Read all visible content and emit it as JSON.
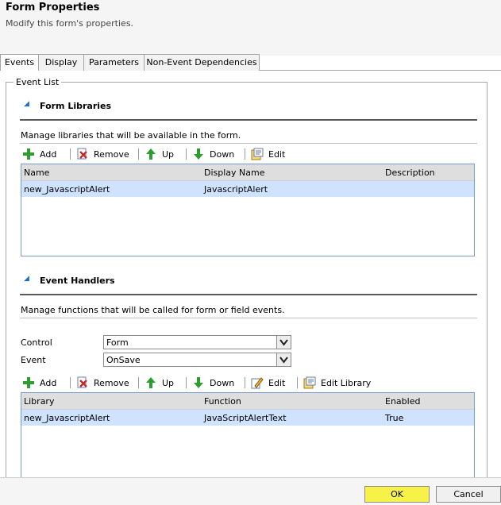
{
  "dialog": {
    "title": "Form Properties",
    "subtitle": "Modify this form's properties."
  },
  "tabs": [
    {
      "label": "Events",
      "active": true
    },
    {
      "label": "Display",
      "active": false
    },
    {
      "label": "Parameters",
      "active": false
    },
    {
      "label": "Non-Event Dependencies",
      "active": false
    }
  ],
  "event_list": {
    "legend": "Event List",
    "form_libraries": {
      "heading": "Form Libraries",
      "description": "Manage libraries that will be available in the form.",
      "toolbar": {
        "add": "Add",
        "remove": "Remove",
        "up": "Up",
        "down": "Down",
        "edit": "Edit"
      },
      "columns": [
        "Name",
        "Display Name",
        "Description"
      ],
      "rows": [
        [
          "new_JavascriptAlert",
          "JavascriptAlert",
          ""
        ]
      ]
    },
    "event_handlers": {
      "heading": "Event Handlers",
      "description": "Manage functions that will be called for form or field events.",
      "control_label": "Control",
      "control_value": "Form",
      "event_label": "Event",
      "event_value": "OnSave",
      "toolbar": {
        "add": "Add",
        "remove": "Remove",
        "up": "Up",
        "down": "Down",
        "edit": "Edit",
        "edit_library": "Edit Library"
      },
      "columns": [
        "Library",
        "Function",
        "Enabled"
      ],
      "rows": [
        [
          "new_JavascriptAlert",
          "JavaScriptAlertText",
          "True"
        ]
      ]
    }
  },
  "footer": {
    "ok": "OK",
    "cancel": "Cancel"
  },
  "colors": {
    "ok_highlight": "#f6f24a",
    "selected_row": "#cfe3ff",
    "add_icon": "#2e9c2e",
    "remove_icon": "#c62828",
    "arrow_icon": "#2e9c2e"
  }
}
